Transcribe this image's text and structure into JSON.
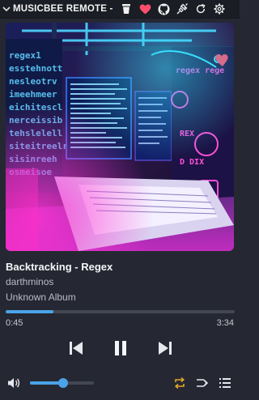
{
  "app": {
    "title": "MUSICBEE REMOTE - ..."
  },
  "track": {
    "title": "Backtracking - Regex",
    "artist": "darthminos",
    "album": "Unknown Album"
  },
  "playback": {
    "elapsed": "0:45",
    "total": "3:34",
    "progress_fraction": 0.21,
    "state": "playing",
    "repeat": "on",
    "shuffle": "off"
  },
  "volume": {
    "fraction": 0.52
  },
  "icons": {
    "collapse": "chevron-down-icon",
    "cup": "cup-icon",
    "favorite": "heart-icon",
    "repo": "github-icon",
    "connect": "plug-icon",
    "refresh": "refresh-icon",
    "settings": "gear-icon",
    "previous": "skip-previous-icon",
    "pause": "pause-icon",
    "next": "skip-next-icon",
    "volume": "speaker-icon",
    "repeat": "repeat-icon",
    "shuffle": "shuffle-icon",
    "queue": "queue-list-icon"
  },
  "colors": {
    "background": "#252832",
    "titlebar": "#1b1d24",
    "accent": "#4aa3e8",
    "heart": "#ff4d6d",
    "repeat_active": "#e6a42b",
    "track_muted": "#434753"
  }
}
